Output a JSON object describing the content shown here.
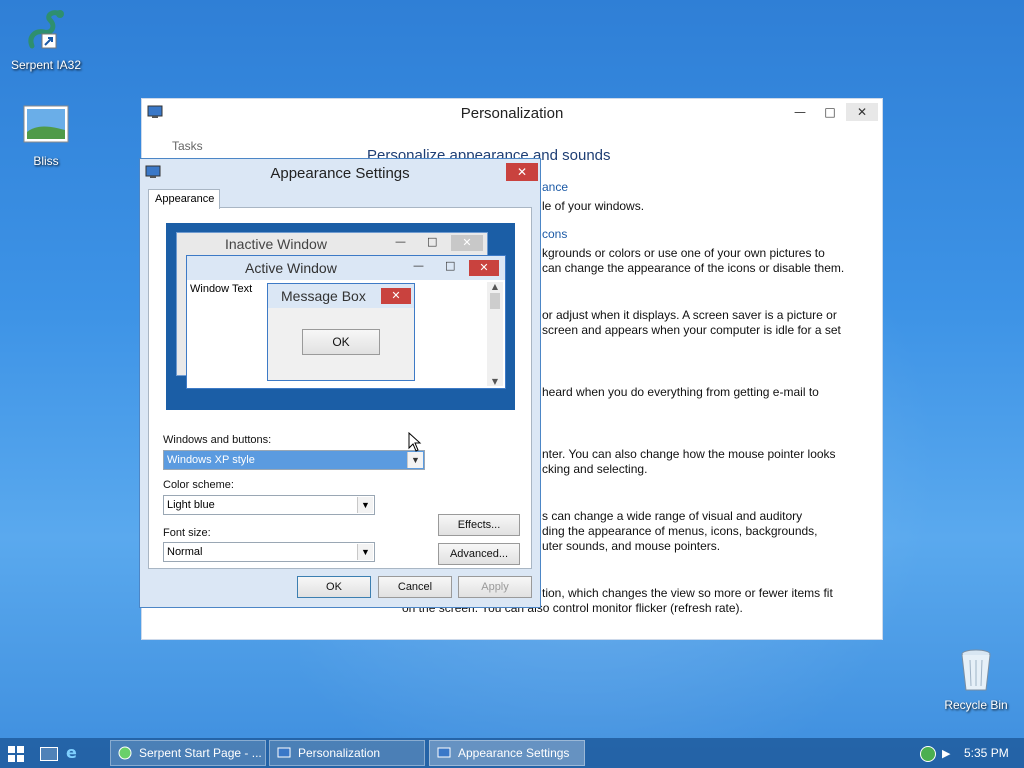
{
  "desktop": {
    "icons": [
      {
        "label": "Serpent IA32",
        "icon": "serpent-icon"
      },
      {
        "label": "Bliss",
        "icon": "image-icon"
      },
      {
        "label": "Recycle Bin",
        "icon": "recycle-bin-icon"
      }
    ]
  },
  "personalization": {
    "title": "Personalization",
    "tasks_label": "Tasks",
    "heading": "Personalize appearance and sounds",
    "lines": [
      {
        "type": "link",
        "text": "ance"
      },
      {
        "type": "text",
        "text": "le of your windows."
      },
      {
        "type": "link",
        "text": "cons"
      },
      {
        "type": "text",
        "text": "kgrounds or colors or use one of your own pictures to"
      },
      {
        "type": "text",
        "text": "can change the appearance of the icons or disable them."
      },
      {
        "type": "text",
        "text": "or adjust when it displays. A screen saver is a picture or"
      },
      {
        "type": "text",
        "text": "screen and appears when your computer is idle for a set"
      },
      {
        "type": "text",
        "text": "heard when you do everything from getting e-mail to"
      },
      {
        "type": "text",
        "text": "nter. You can also change how the mouse pointer looks"
      },
      {
        "type": "text",
        "text": "cking and selecting."
      },
      {
        "type": "text",
        "text": "s can change a wide range of visual and auditory"
      },
      {
        "type": "text",
        "text": "ding the appearance of menus, icons, backgrounds,"
      },
      {
        "type": "text",
        "text": "uter sounds, and mouse pointers."
      },
      {
        "type": "text",
        "text": "tion, which changes the view so more or fewer items fit"
      },
      {
        "type": "text",
        "text": "on the screen. You can also control monitor flicker (refresh rate)."
      }
    ]
  },
  "appearance": {
    "title": "Appearance Settings",
    "tab": "Appearance",
    "preview": {
      "inactive_title": "Inactive Window",
      "active_title": "Active Window",
      "window_text": "Window Text",
      "message_title": "Message Box",
      "message_ok": "OK"
    },
    "windows_buttons_label": "Windows and buttons:",
    "windows_buttons_value": "Windows XP style",
    "color_scheme_label": "Color scheme:",
    "color_scheme_value": "Light blue",
    "font_size_label": "Font size:",
    "font_size_value": "Normal",
    "effects_label": "Effects...",
    "advanced_label": "Advanced...",
    "ok_label": "OK",
    "cancel_label": "Cancel",
    "apply_label": "Apply"
  },
  "taskbar": {
    "tasks": [
      {
        "label": "Serpent Start Page - ...",
        "icon": "browser-icon"
      },
      {
        "label": "Personalization",
        "icon": "personalization-icon"
      },
      {
        "label": "Appearance Settings",
        "icon": "appearance-icon"
      }
    ],
    "time": "5:35 PM"
  },
  "colors": {
    "accent": "#1b5ea6",
    "close": "#c9423e",
    "link": "#1c5aa6"
  }
}
